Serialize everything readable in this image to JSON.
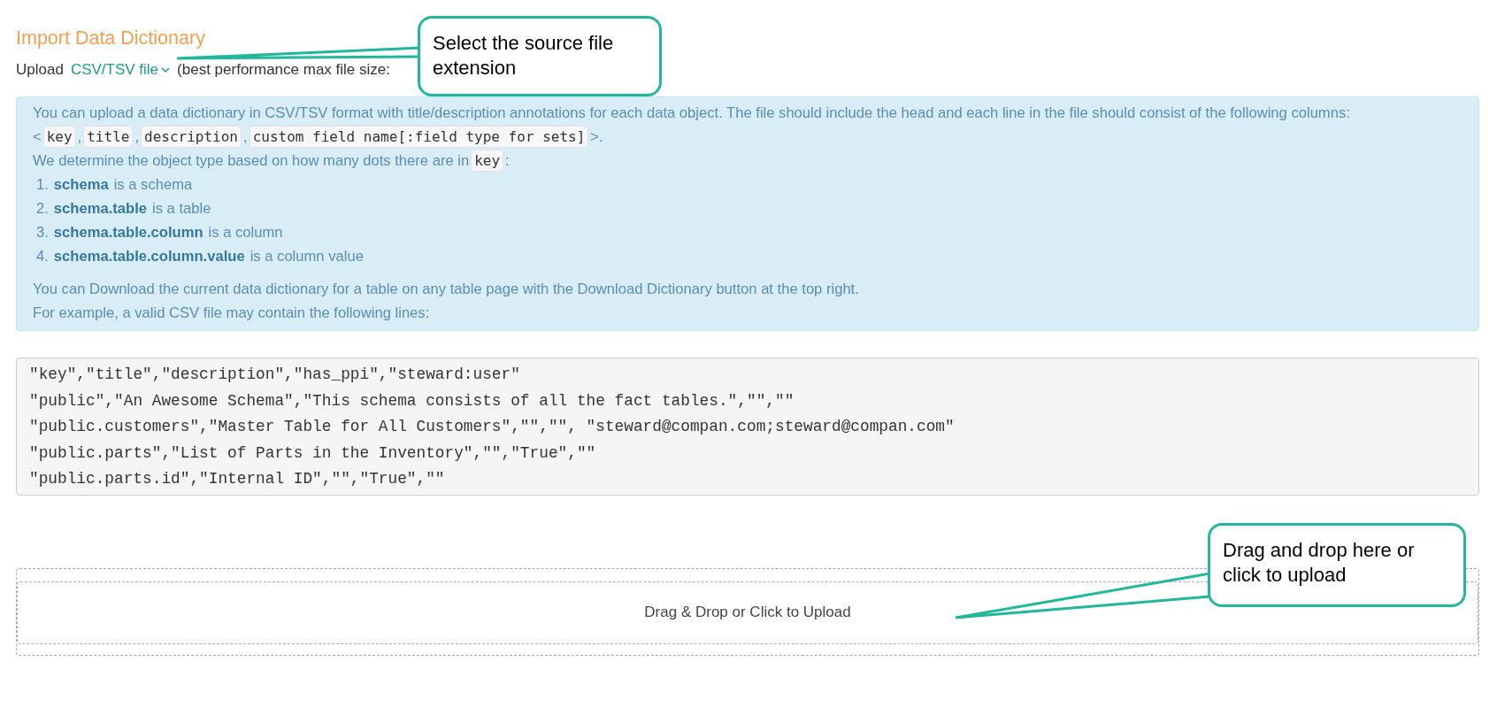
{
  "page_title": "Import Data Dictionary",
  "upload": {
    "label": "Upload",
    "format": "CSV/TSV file",
    "note": "(best performance max file size:"
  },
  "info": {
    "intro": "You can upload a data dictionary in CSV/TSV format with title/description annotations for each data object. The file should include the head and each line in the file should consist of the following columns:",
    "columns_line": [
      {
        "kind": "text",
        "text": "<"
      },
      {
        "kind": "code",
        "text": "key"
      },
      {
        "kind": "text",
        "text": ","
      },
      {
        "kind": "code",
        "text": "title"
      },
      {
        "kind": "text",
        "text": ","
      },
      {
        "kind": "code",
        "text": "description"
      },
      {
        "kind": "text",
        "text": ","
      },
      {
        "kind": "code",
        "text": "custom field name[:field type for sets]"
      },
      {
        "kind": "text",
        "text": ">."
      }
    ],
    "dots_line": [
      {
        "kind": "text",
        "text": "We determine the object type based on how many dots there are in"
      },
      {
        "kind": "code",
        "text": "key"
      },
      {
        "kind": "text",
        "text": ":"
      }
    ],
    "types": [
      {
        "number": "1.",
        "key": "schema",
        "text": "is a schema"
      },
      {
        "number": "2.",
        "key": "schema.table",
        "text": "is a table"
      },
      {
        "number": "3.",
        "key": "schema.table.column",
        "text": "is a column"
      },
      {
        "number": "4.",
        "key": "schema.table.column.value",
        "text": "is a column value"
      }
    ],
    "download_note": "You can Download the current data dictionary for a table on any table page with the Download Dictionary button at the top right.",
    "example_note": "For example, a valid CSV file may contain the following lines:"
  },
  "example_lines": [
    "\"key\",\"title\",\"description\",\"has_ppi\",\"steward:user\"",
    "\"public\",\"An Awesome Schema\",\"This schema consists of all the fact tables.\",\"\",\"\"",
    "\"public.customers\",\"Master Table for All Customers\",\"\",\"\", \"steward@compan.com;steward@compan.com\"",
    "\"public.parts\",\"List of Parts in the Inventory\",\"\",\"True\",\"\"",
    "\"public.parts.id\",\"Internal ID\",\"\",\"True\",\"\""
  ],
  "dropzone": {
    "label": "Drag & Drop or Click to Upload"
  },
  "callouts": [
    {
      "text": "Select the source file extension"
    },
    {
      "text": "Drag and drop here or click to upload"
    }
  ]
}
